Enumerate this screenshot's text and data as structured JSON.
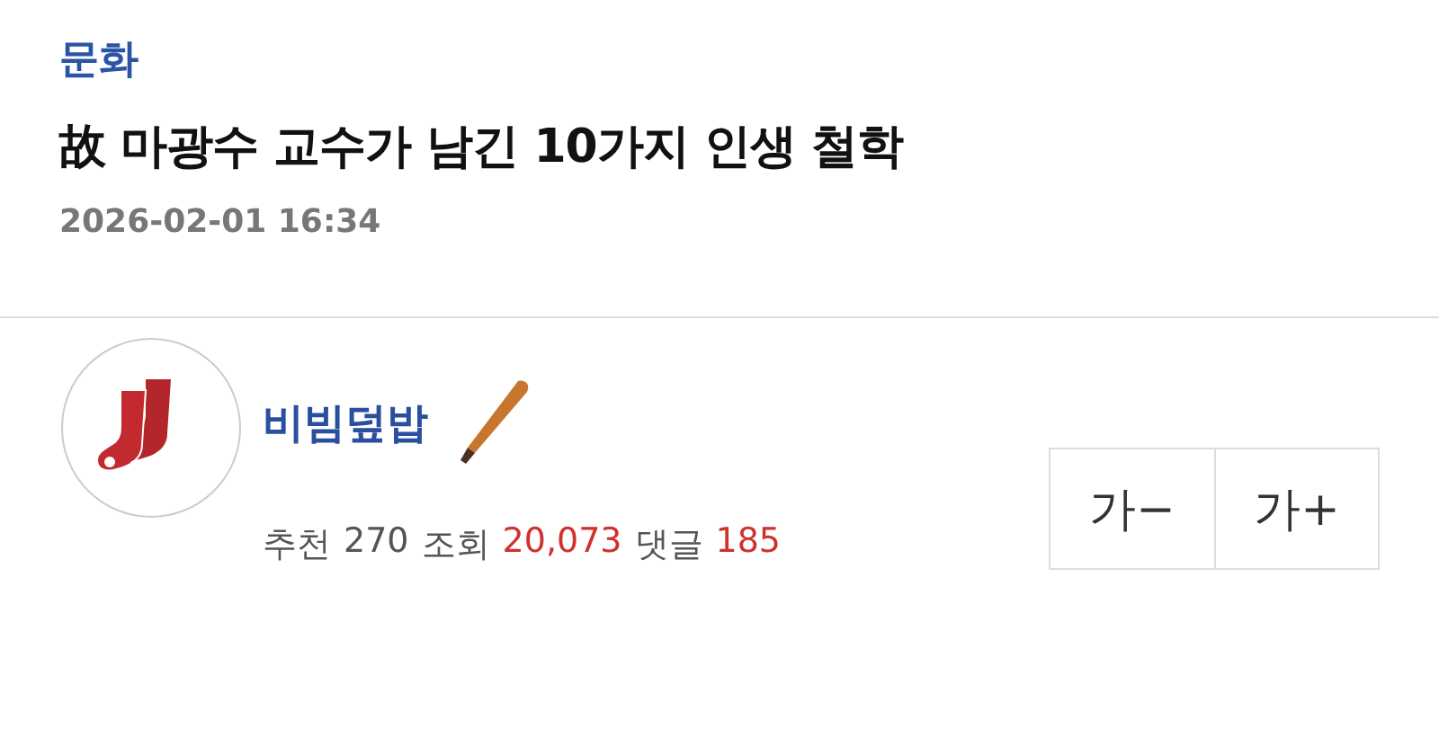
{
  "category": "문화",
  "title": "故 마광수 교수가 남긴 10가지 인생 철학",
  "date": "2026-02-01 16:34",
  "author": {
    "name": "비빔덮밥",
    "stats": [
      {
        "label": "추천",
        "value": "270",
        "color": "#555555"
      },
      {
        "label": "조회",
        "value": "20,073",
        "color": "#d0312d"
      },
      {
        "label": "댓글",
        "value": "185",
        "color": "#d0312d"
      }
    ]
  },
  "font_buttons": [
    "가−",
    "가+"
  ]
}
